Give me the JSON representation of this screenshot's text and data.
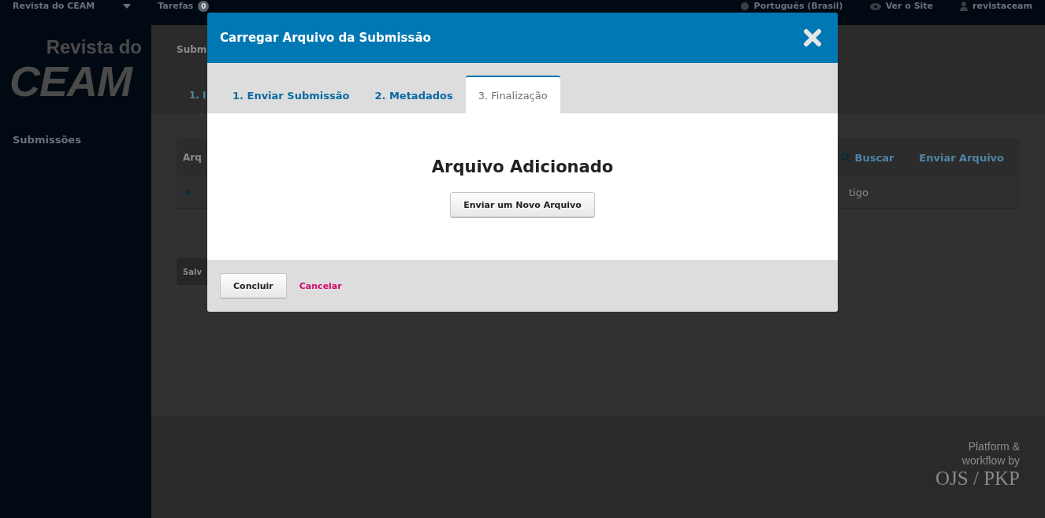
{
  "top_bar": {
    "site": "Revista do CEAM",
    "tasks": "Tarefas",
    "tasks_count": "0",
    "language": "Português (Brasil)",
    "view_site": "Ver o Site",
    "user": "revistaceam"
  },
  "logo": {
    "line_1": "Revista do",
    "line_2": "CEAM"
  },
  "sidebar": {
    "items": [
      {
        "label": "Submissões"
      }
    ]
  },
  "page": {
    "heading": "Subm",
    "tab": "1. I",
    "panel_title": "Arq",
    "search": "Buscar",
    "upload": "Enviar Arquivo",
    "row_text": "tigo",
    "save": "Salv"
  },
  "footer": {
    "line_1": "Platform &",
    "line_2": "workflow by",
    "brand": "OJS / PKP"
  },
  "modal": {
    "title": "Carregar Arquivo da Submissão",
    "tabs": [
      {
        "label": "1. Enviar Submissão",
        "selected": false
      },
      {
        "label": "2. Metadados",
        "selected": false
      },
      {
        "label": "3. Finalização",
        "selected": true
      }
    ],
    "message": "Arquivo Adicionado",
    "new_file_button": "Enviar um Novo Arquivo",
    "finish_button": "Concluir",
    "cancel_link": "Cancelar"
  }
}
